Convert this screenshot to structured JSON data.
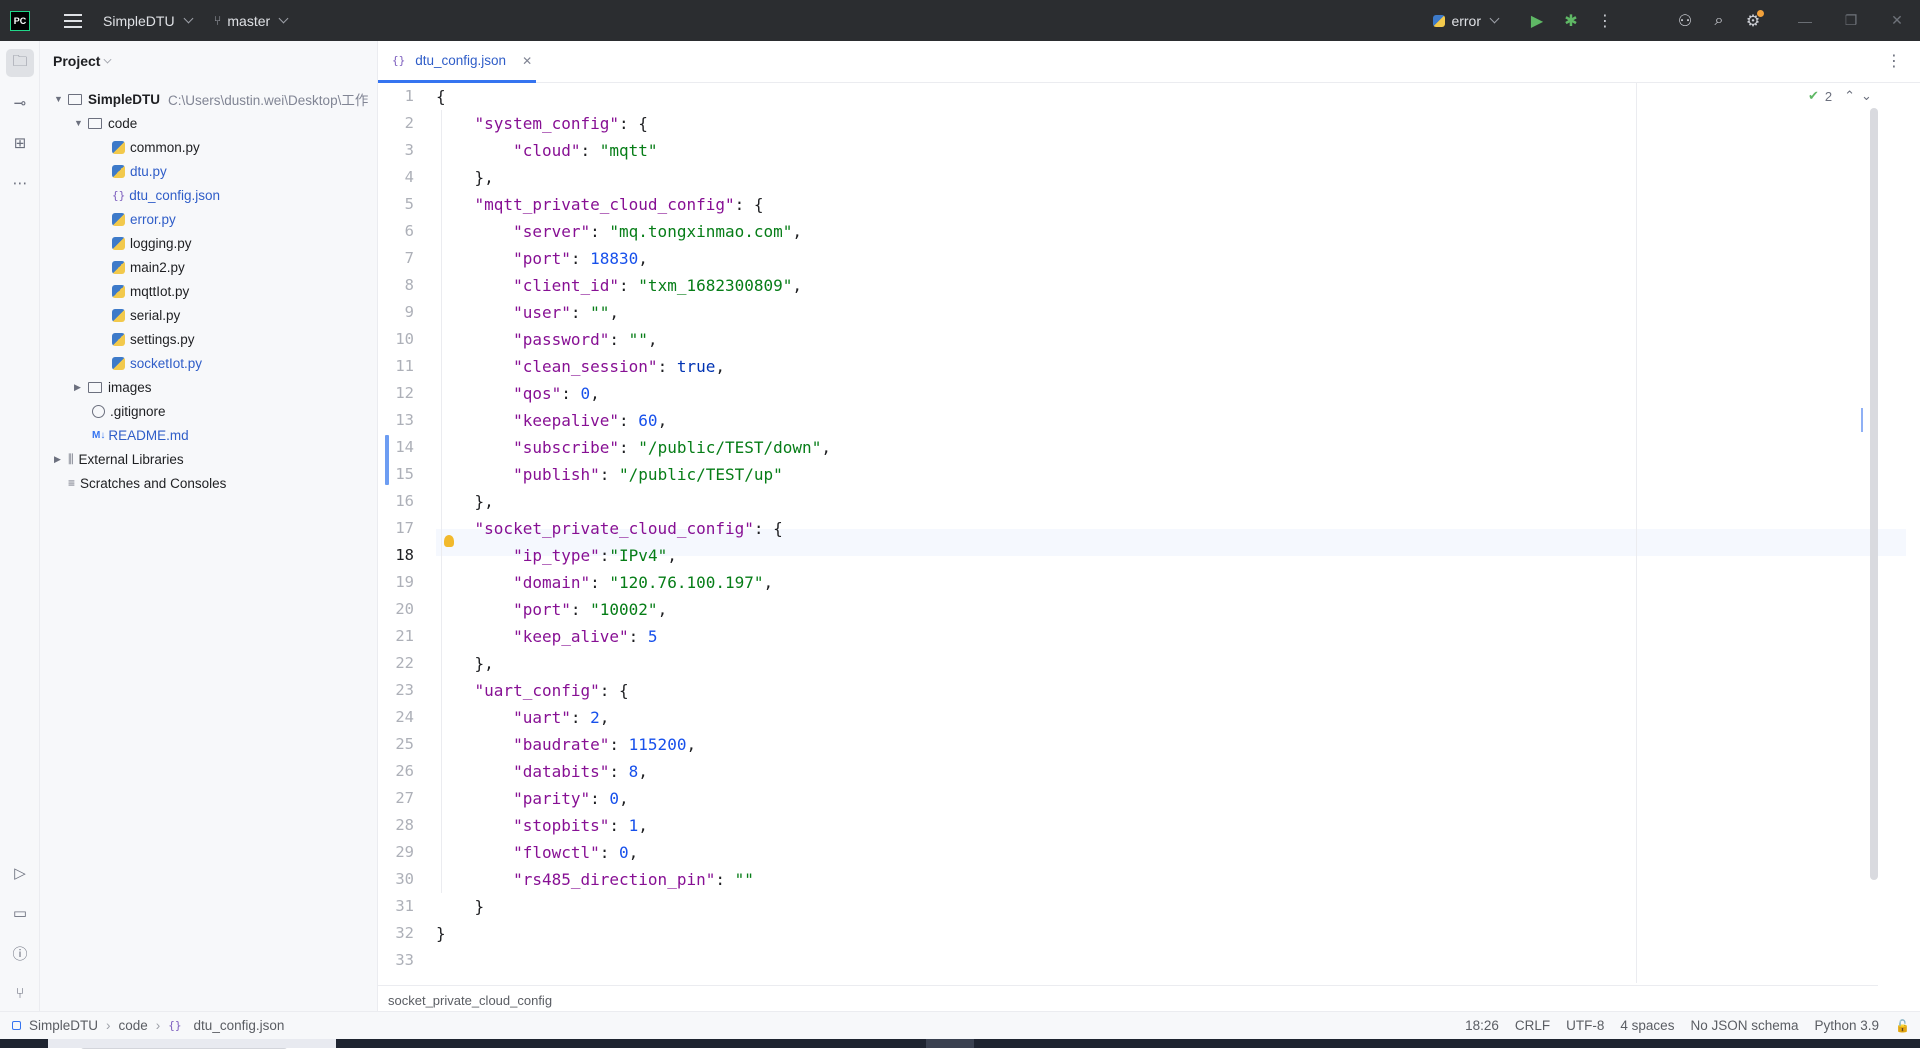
{
  "titlebar": {
    "project_name": "SimpleDTU",
    "branch": "master",
    "run_config": "error"
  },
  "project_panel": {
    "title": "Project",
    "root": {
      "name": "SimpleDTU",
      "path": "C:\\Users\\dustin.wei\\Desktop\\工作"
    },
    "folder_code": "code",
    "files": [
      {
        "name": "common.py",
        "modified": false
      },
      {
        "name": "dtu.py",
        "modified": true
      },
      {
        "name": "dtu_config.json",
        "modified": true
      },
      {
        "name": "error.py",
        "modified": true
      },
      {
        "name": "logging.py",
        "modified": false
      },
      {
        "name": "main2.py",
        "modified": false
      },
      {
        "name": "mqttIot.py",
        "modified": false
      },
      {
        "name": "serial.py",
        "modified": false
      },
      {
        "name": "settings.py",
        "modified": false
      },
      {
        "name": "socketIot.py",
        "modified": true
      }
    ],
    "folder_images": "images",
    "gitignore": ".gitignore",
    "readme": "README.md",
    "external_libraries": "External Libraries",
    "scratches": "Scratches and Consoles"
  },
  "editor": {
    "tab_label": "dtu_config.json",
    "inspection_count": "2",
    "current_line": 18,
    "line_numbers": [
      "1",
      "2",
      "3",
      "4",
      "5",
      "6",
      "7",
      "8",
      "9",
      "10",
      "11",
      "12",
      "13",
      "14",
      "15",
      "16",
      "17",
      "18",
      "19",
      "20",
      "21",
      "22",
      "23",
      "24",
      "25",
      "26",
      "27",
      "28",
      "29",
      "30",
      "31",
      "32",
      "33"
    ],
    "code": {
      "l2_key": "\"system_config\"",
      "l3_key": "\"cloud\"",
      "l3_val": "\"mqtt\"",
      "l5_key": "\"mqtt_private_cloud_config\"",
      "l6_key": "\"server\"",
      "l6_val": "\"mq.tongxinmao.com\"",
      "l7_key": "\"port\"",
      "l7_val": "18830",
      "l8_key": "\"client_id\"",
      "l8_val": "\"txm_1682300809\"",
      "l9_key": "\"user\"",
      "l9_val": "\"\"",
      "l10_key": "\"password\"",
      "l10_val": "\"\"",
      "l11_key": "\"clean_session\"",
      "l11_val": "true",
      "l12_key": "\"qos\"",
      "l12_val": "0",
      "l13_key": "\"keepalive\"",
      "l13_val": "60",
      "l14_key": "\"subscribe\"",
      "l14_val": "\"/public/TEST/down\"",
      "l15_key": "\"publish\"",
      "l15_val": "\"/public/TEST/up\"",
      "l17_key": "\"socket_private_cloud_config\"",
      "l18_key": "\"ip_type\"",
      "l18_val": "\"IPv4\"",
      "l19_key": "\"domain\"",
      "l19_val": "\"120.76.100.197\"",
      "l20_key": "\"port\"",
      "l20_val": "\"10002\"",
      "l21_key": "\"keep_alive\"",
      "l21_val": "5",
      "l23_key": "\"uart_config\"",
      "l24_key": "\"uart\"",
      "l24_val": "2",
      "l25_key": "\"baudrate\"",
      "l25_val": "115200",
      "l26_key": "\"databits\"",
      "l26_val": "8",
      "l27_key": "\"parity\"",
      "l27_val": "0",
      "l28_key": "\"stopbits\"",
      "l28_val": "1",
      "l29_key": "\"flowctl\"",
      "l29_val": "0",
      "l30_key": "\"rs485_direction_pin\"",
      "l30_val": "\"\""
    },
    "breadcrumb": "socket_private_cloud_config"
  },
  "statusbar": {
    "crumbs": [
      "SimpleDTU",
      "code",
      "dtu_config.json"
    ],
    "position": "18:26",
    "line_ending": "CRLF",
    "encoding": "UTF-8",
    "indent": "4 spaces",
    "schema": "No JSON schema",
    "interpreter": "Python 3.9"
  },
  "colors": {
    "key": "#871094",
    "string": "#067d17",
    "number": "#1750eb",
    "keyword": "#0033b3",
    "accent": "#3574f0"
  }
}
